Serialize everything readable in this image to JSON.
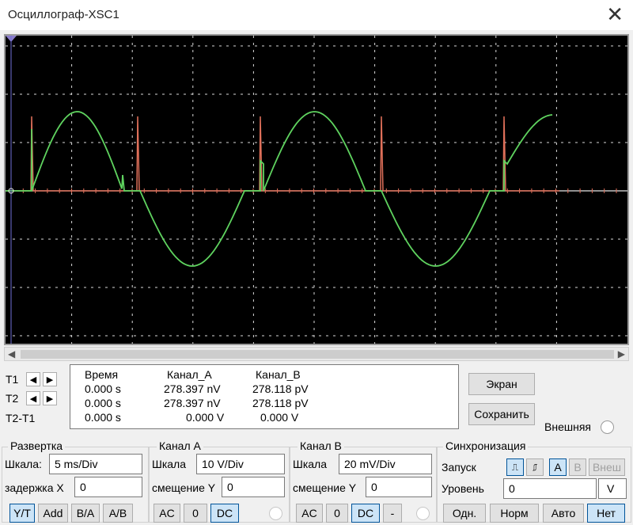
{
  "window": {
    "title": "Осциллограф-XSC1"
  },
  "colors": {
    "channel_a": "#5fd35f",
    "channel_b": "#e0705a",
    "screen_bg": "#000000",
    "grid": "#d8d8d8"
  },
  "cursors": {
    "t1": "T1",
    "t2": "T2",
    "t2_t1": "T2-T1"
  },
  "readout": {
    "headers": [
      "Время",
      "Канал_A",
      "Канал_B"
    ],
    "rows": [
      [
        "0.000 s",
        "278.397 nV",
        "278.118 pV"
      ],
      [
        "0.000 s",
        "278.397 nV",
        "278.118 pV"
      ],
      [
        "0.000 s",
        "0.000 V",
        "0.000 V"
      ]
    ]
  },
  "side": {
    "screen_btn": "Экран",
    "save_btn": "Сохранить",
    "external_label": "Внешняя"
  },
  "timebase": {
    "legend": "Развертка",
    "scale_label": "Шкала:",
    "scale_value": "5 ms/Div",
    "delay_label": "задержка X",
    "delay_value": "0",
    "buttons": [
      "Y/T",
      "Add",
      "B/A",
      "A/B"
    ]
  },
  "channel_a": {
    "legend": "Канал А",
    "scale_label": "Шкала",
    "scale_value": "10  V/Div",
    "offset_label": "смещение Y",
    "offset_value": "0",
    "buttons": [
      "AC",
      "0",
      "DC"
    ]
  },
  "channel_b": {
    "legend": "Канал В",
    "scale_label": "Шкала",
    "scale_value": "20 mV/Div",
    "offset_label": "смещение Y",
    "offset_value": "0",
    "buttons": [
      "AC",
      "0",
      "DC",
      "-"
    ]
  },
  "trigger": {
    "legend": "Синхронизация",
    "launch_label": "Запуск",
    "source_buttons": [
      "A",
      "B",
      "Внеш"
    ],
    "level_label": "Уровень",
    "level_value": "0",
    "level_unit": "V",
    "mode_buttons": [
      "Одн.",
      "Норм",
      "Авто",
      "Нет"
    ]
  }
}
